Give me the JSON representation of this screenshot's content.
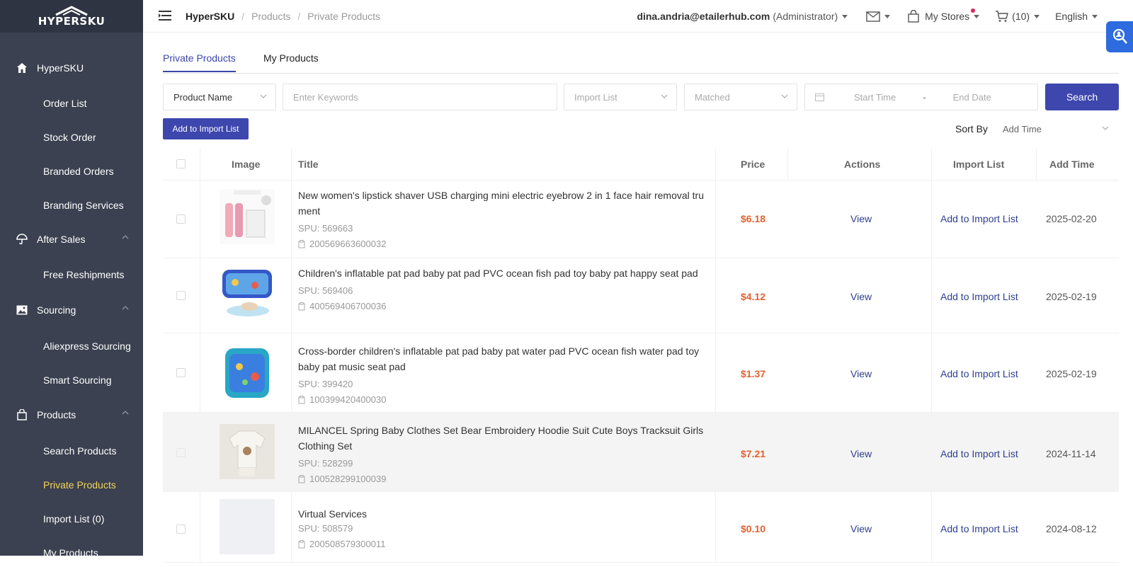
{
  "brand": {
    "logo_text": "HYPERSKU"
  },
  "sidebar": {
    "items": [
      {
        "label": "HyperSKU",
        "kind": "top",
        "icon": "home-icon"
      },
      {
        "label": "Order List",
        "kind": "sub"
      },
      {
        "label": "Stock Order",
        "kind": "sub"
      },
      {
        "label": "Branded Orders",
        "kind": "sub"
      },
      {
        "label": "Branding Services",
        "kind": "sub"
      },
      {
        "label": "After Sales",
        "kind": "top",
        "icon": "umbrella-icon"
      },
      {
        "label": "Free Reshipments",
        "kind": "sub"
      },
      {
        "label": "Sourcing",
        "kind": "top",
        "icon": "image-icon"
      },
      {
        "label": "Aliexpress Sourcing",
        "kind": "sub"
      },
      {
        "label": "Smart Sourcing",
        "kind": "sub"
      },
      {
        "label": "Products",
        "kind": "top",
        "icon": "bag-icon"
      },
      {
        "label": "Search Products",
        "kind": "sub"
      },
      {
        "label": "Private Products",
        "kind": "sub",
        "active": true
      },
      {
        "label": "Import List (0)",
        "kind": "sub"
      },
      {
        "label": "My Products",
        "kind": "sub"
      }
    ]
  },
  "header": {
    "breadcrumb": [
      "HyperSKU",
      "Products",
      "Private Products"
    ],
    "user_email": "dina.andria@etailerhub.com",
    "user_role": "(Administrator)",
    "my_stores": "My Stores",
    "cart_count": "(10)",
    "language": "English"
  },
  "tabs": [
    "Private Products",
    "My Products"
  ],
  "filters": {
    "field_select": "Product Name",
    "keyword_placeholder": "Enter Keywords",
    "import_list_select": "Import List",
    "matched_select": "Matched",
    "start_placeholder": "Start Time",
    "date_sep": "-",
    "end_placeholder": "End Date",
    "search_label": "Search"
  },
  "toolbar": {
    "add_to_import_label": "Add to Import List",
    "sort_label": "Sort By",
    "sort_value": "Add Time"
  },
  "table": {
    "headers": {
      "image": "Image",
      "title": "Title",
      "price": "Price",
      "actions": "Actions",
      "import_list": "Import List",
      "add_time": "Add Time"
    },
    "rows": [
      {
        "title": "New women's lipstick shaver USB charging mini electric eyebrow 2 in 1 face hair removal tru ment",
        "spu": "SPU: 569663",
        "sku": "200569663600032",
        "price": "$6.18",
        "action": "View",
        "import": "Add to Import List",
        "date": "2025-02-20"
      },
      {
        "title": "Children's inflatable pat pad baby pat pad PVC ocean fish pad toy baby pat happy seat pad",
        "spu": "SPU: 569406",
        "sku": "400569406700036",
        "price": "$4.12",
        "action": "View",
        "import": "Add to Import List",
        "date": "2025-02-19"
      },
      {
        "title": "Cross-border children's inflatable pat pad baby pat water pad PVC ocean fish water pad toy baby pat music seat pad",
        "spu": "SPU: 399420",
        "sku": "100399420400030",
        "price": "$1.37",
        "action": "View",
        "import": "Add to Import List",
        "date": "2025-02-19"
      },
      {
        "title": "MILANCEL Spring Baby Clothes Set Bear Embroidery Hoodie Suit Cute Boys Tracksuit Girls Clothing Set",
        "spu": "SPU: 528299",
        "sku": "100528299100039",
        "price": "$7.21",
        "action": "View",
        "import": "Add to Import List",
        "date": "2024-11-14"
      },
      {
        "title": "Virtual Services",
        "spu": "SPU: 508579",
        "sku": "200508579300011",
        "price": "$0.10",
        "action": "View",
        "import": "Add to Import List",
        "date": "2024-08-12"
      }
    ]
  },
  "colors": {
    "accent": "#3d47ad",
    "sidebar": "#3b4150",
    "price": "#e4602f",
    "active_nav": "#f2d45c"
  }
}
